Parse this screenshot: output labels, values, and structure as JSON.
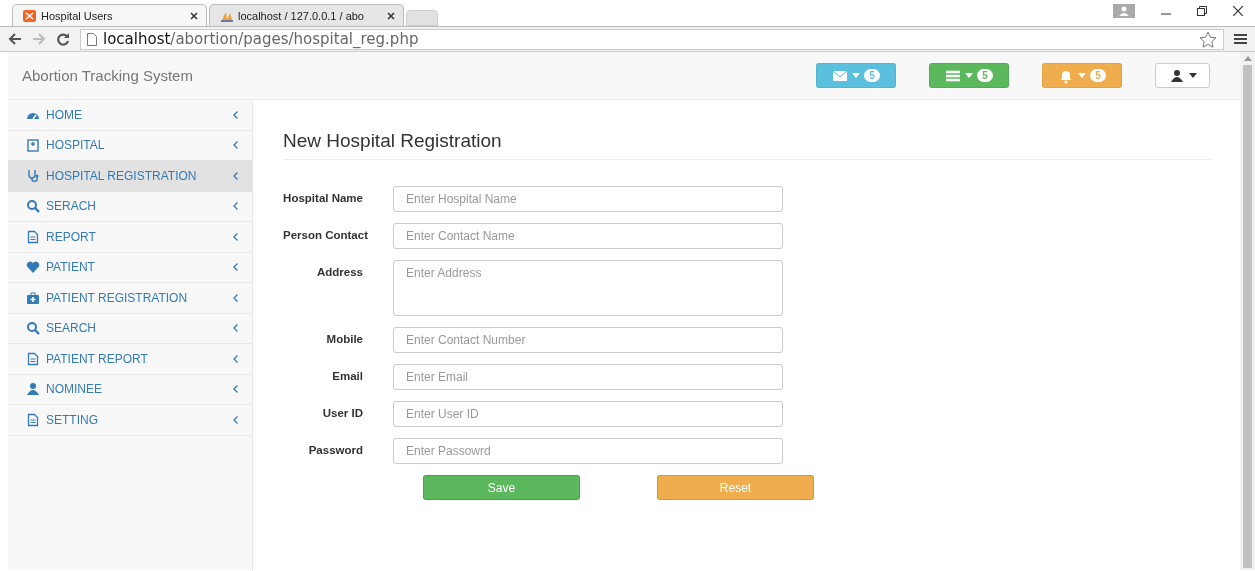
{
  "browser": {
    "tabs": [
      {
        "title": "Hospital Users",
        "selected": true
      },
      {
        "title": "localhost / 127.0.0.1 / abo",
        "selected": false
      }
    ],
    "address": {
      "host": "localhost",
      "path": "/abortion/pages/hospital_reg.php"
    }
  },
  "app": {
    "brand": "Abortion Tracking System",
    "nav_buttons": [
      {
        "kind": "mail",
        "color": "#5bc0de",
        "count": "5"
      },
      {
        "kind": "tasks",
        "color": "#5cb85c",
        "count": "5"
      },
      {
        "kind": "alerts",
        "color": "#f0ad4e",
        "count": "5"
      },
      {
        "kind": "user",
        "color": "#ffffff"
      }
    ]
  },
  "sidebar": {
    "items": [
      {
        "label": "HOME",
        "selected": false
      },
      {
        "label": "HOSPITAL",
        "selected": false
      },
      {
        "label": "HOSPITAL REGISTRATION",
        "selected": true
      },
      {
        "label": "SERACH",
        "selected": false
      },
      {
        "label": "REPORT",
        "selected": false
      },
      {
        "label": "PATIENT",
        "selected": false
      },
      {
        "label": "PATIENT REGISTRATION",
        "selected": false
      },
      {
        "label": "SEARCH",
        "selected": false
      },
      {
        "label": "PATIENT REPORT",
        "selected": false
      },
      {
        "label": "NOMINEE",
        "selected": false
      },
      {
        "label": "SETTING",
        "selected": false
      }
    ]
  },
  "form": {
    "title": "New Hospital Registration",
    "fields": [
      {
        "label": "Hospital Name",
        "placeholder": "Enter Hospital Name",
        "kind": "input"
      },
      {
        "label": "Person Contact",
        "placeholder": "Enter Contact Name",
        "kind": "input"
      },
      {
        "label": "Address",
        "placeholder": "Enter Address",
        "kind": "textarea"
      },
      {
        "label": "Mobile",
        "placeholder": "Enter Contact Number",
        "kind": "input"
      },
      {
        "label": "Email",
        "placeholder": "Enter Email",
        "kind": "input"
      },
      {
        "label": "User ID",
        "placeholder": "Enter User ID",
        "kind": "input"
      },
      {
        "label": "Password",
        "placeholder": "Enter Passowrd",
        "kind": "input"
      }
    ],
    "buttons": [
      {
        "label": "Save",
        "color": "#5cb85c"
      },
      {
        "label": "Reset",
        "color": "#f0ad4e"
      }
    ]
  }
}
